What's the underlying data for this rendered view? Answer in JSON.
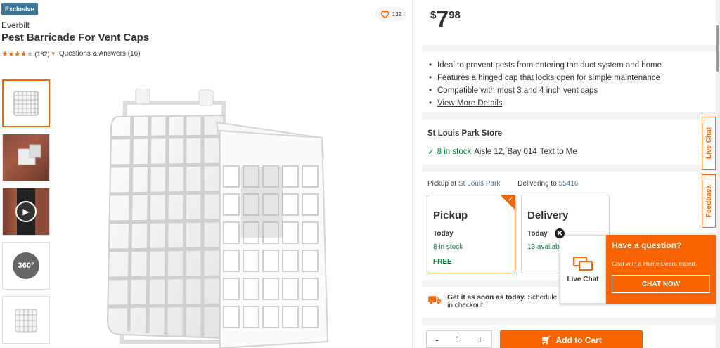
{
  "product": {
    "badge": "Exclusive",
    "brand": "Everbilt",
    "title": "Pest Barricade For Vent Caps",
    "stars": "★★★★",
    "star_empty": "★",
    "review_count": "(182)",
    "qa": "Questions & Answers (16)",
    "favorites": "132"
  },
  "gallery": {
    "spin_label": "360°"
  },
  "price": {
    "dollar": "$",
    "whole": "7",
    "cents": "98"
  },
  "highlights": [
    "Ideal to prevent pests from entering the duct system and home",
    "Features a hinged cap that locks open for simple maintenance",
    "Compatible with most 3 and 4 inch vent caps"
  ],
  "more_details": "View More Details",
  "store": {
    "name": "St Louis Park Store",
    "stock": "8 in stock",
    "aisle": "Aisle 12, Bay 014",
    "text_me": "Text to Me"
  },
  "fulfillment": {
    "pickup_at_label": "Pickup at",
    "pickup_store": "St Louis Park",
    "delivering_label": "Delivering to",
    "zip": "55416",
    "pickup": {
      "title": "Pickup",
      "when": "Today",
      "stock": "8 in stock",
      "cost": "FREE"
    },
    "delivery": {
      "title": "Delivery",
      "when": "Today",
      "stock": "13 available"
    }
  },
  "shipping": {
    "bold": "Get it as soon as today.",
    "rest": "Schedule",
    "line2": "in checkout."
  },
  "cart": {
    "minus": "-",
    "qty": "1",
    "plus": "+",
    "add_label": "Add to Cart"
  },
  "side_tabs": {
    "live_chat": "Live Chat",
    "feedback": "Feedback"
  },
  "chat_popup": {
    "left_label": "Live Chat",
    "question": "Have a question?",
    "sub": "Chat with a Home Depot expert.",
    "button": "CHAT NOW"
  },
  "colors": {
    "brand_orange": "#f96302",
    "stock_green": "#00873c",
    "link_blue": "#3e7697"
  }
}
